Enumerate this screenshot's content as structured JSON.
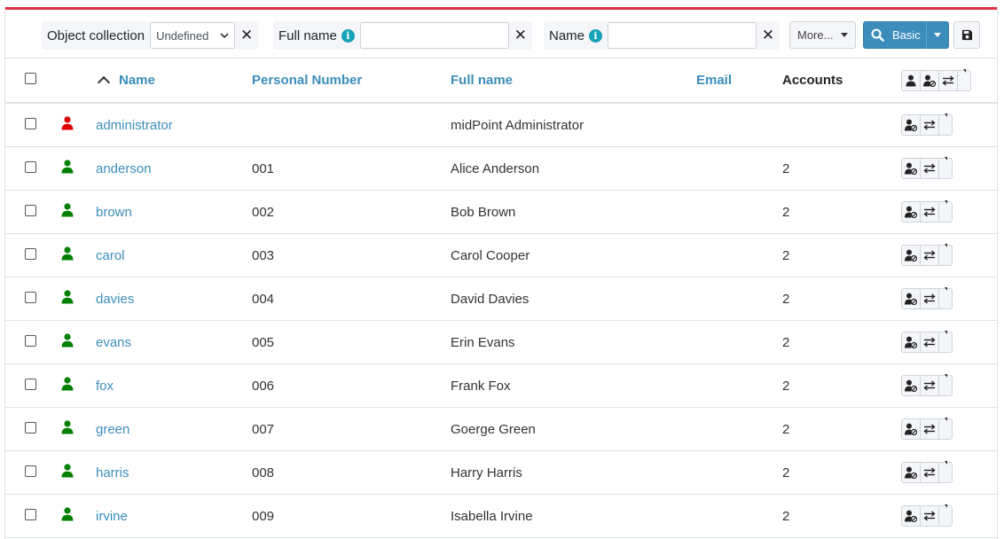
{
  "filters": {
    "object_collection": {
      "label": "Object collection",
      "value": "Undefined"
    },
    "full_name": {
      "label": "Full name",
      "value": ""
    },
    "name": {
      "label": "Name",
      "value": ""
    },
    "more_label": "More...",
    "basic_label": "Basic",
    "clear_glyph": "✕",
    "info_glyph": "i"
  },
  "table": {
    "columns": {
      "name": "Name",
      "personal_number": "Personal Number",
      "full_name": "Full name",
      "email": "Email",
      "accounts": "Accounts"
    },
    "rows": [
      {
        "name": "administrator",
        "personal_number": "",
        "full_name": "midPoint Administrator",
        "email": "",
        "accounts": "",
        "status": "admin"
      },
      {
        "name": "anderson",
        "personal_number": "001",
        "full_name": "Alice Anderson",
        "email": "",
        "accounts": "2",
        "status": "active"
      },
      {
        "name": "brown",
        "personal_number": "002",
        "full_name": "Bob Brown",
        "email": "",
        "accounts": "2",
        "status": "active"
      },
      {
        "name": "carol",
        "personal_number": "003",
        "full_name": "Carol Cooper",
        "email": "",
        "accounts": "2",
        "status": "active"
      },
      {
        "name": "davies",
        "personal_number": "004",
        "full_name": "David Davies",
        "email": "",
        "accounts": "2",
        "status": "active"
      },
      {
        "name": "evans",
        "personal_number": "005",
        "full_name": "Erin Evans",
        "email": "",
        "accounts": "2",
        "status": "active"
      },
      {
        "name": "fox",
        "personal_number": "006",
        "full_name": "Frank Fox",
        "email": "",
        "accounts": "2",
        "status": "active"
      },
      {
        "name": "green",
        "personal_number": "007",
        "full_name": "Goerge Green",
        "email": "",
        "accounts": "2",
        "status": "active"
      },
      {
        "name": "harris",
        "personal_number": "008",
        "full_name": "Harry Harris",
        "email": "",
        "accounts": "2",
        "status": "active"
      },
      {
        "name": "irvine",
        "personal_number": "009",
        "full_name": "Isabella Irvine",
        "email": "",
        "accounts": "2",
        "status": "active"
      }
    ]
  },
  "colors": {
    "accent": "#3c8dbc",
    "top_border": "#dc3545",
    "icon_active": "#008000",
    "icon_admin": "#e00000",
    "info": "#17a2b8"
  },
  "icons": {
    "search": "search-icon",
    "save": "floppy-disk-icon",
    "user": "user-icon",
    "user_unassign": "user-slash-icon",
    "exchange": "exchange-arrows-icon"
  }
}
